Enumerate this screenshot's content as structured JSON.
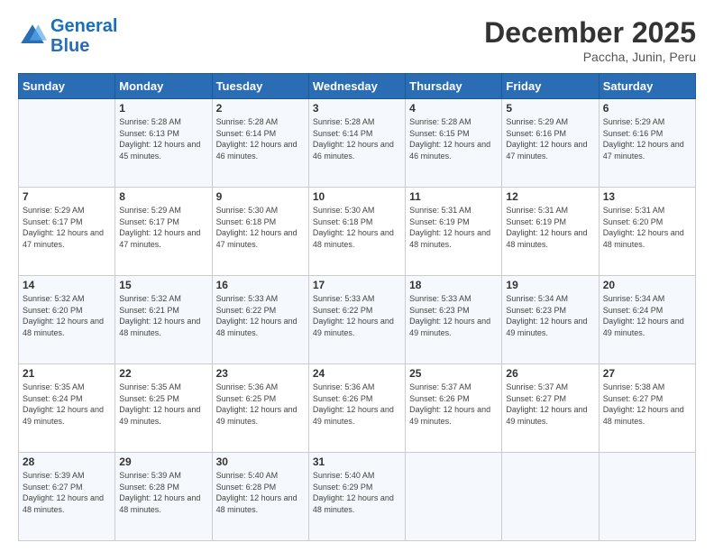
{
  "header": {
    "logo_line1": "General",
    "logo_line2": "Blue",
    "month_title": "December 2025",
    "location": "Paccha, Junin, Peru"
  },
  "weekdays": [
    "Sunday",
    "Monday",
    "Tuesday",
    "Wednesday",
    "Thursday",
    "Friday",
    "Saturday"
  ],
  "weeks": [
    [
      {
        "day": "",
        "sunrise": "",
        "sunset": "",
        "daylight": ""
      },
      {
        "day": "1",
        "sunrise": "Sunrise: 5:28 AM",
        "sunset": "Sunset: 6:13 PM",
        "daylight": "Daylight: 12 hours and 45 minutes."
      },
      {
        "day": "2",
        "sunrise": "Sunrise: 5:28 AM",
        "sunset": "Sunset: 6:14 PM",
        "daylight": "Daylight: 12 hours and 46 minutes."
      },
      {
        "day": "3",
        "sunrise": "Sunrise: 5:28 AM",
        "sunset": "Sunset: 6:14 PM",
        "daylight": "Daylight: 12 hours and 46 minutes."
      },
      {
        "day": "4",
        "sunrise": "Sunrise: 5:28 AM",
        "sunset": "Sunset: 6:15 PM",
        "daylight": "Daylight: 12 hours and 46 minutes."
      },
      {
        "day": "5",
        "sunrise": "Sunrise: 5:29 AM",
        "sunset": "Sunset: 6:16 PM",
        "daylight": "Daylight: 12 hours and 47 minutes."
      },
      {
        "day": "6",
        "sunrise": "Sunrise: 5:29 AM",
        "sunset": "Sunset: 6:16 PM",
        "daylight": "Daylight: 12 hours and 47 minutes."
      }
    ],
    [
      {
        "day": "7",
        "sunrise": "Sunrise: 5:29 AM",
        "sunset": "Sunset: 6:17 PM",
        "daylight": "Daylight: 12 hours and 47 minutes."
      },
      {
        "day": "8",
        "sunrise": "Sunrise: 5:29 AM",
        "sunset": "Sunset: 6:17 PM",
        "daylight": "Daylight: 12 hours and 47 minutes."
      },
      {
        "day": "9",
        "sunrise": "Sunrise: 5:30 AM",
        "sunset": "Sunset: 6:18 PM",
        "daylight": "Daylight: 12 hours and 47 minutes."
      },
      {
        "day": "10",
        "sunrise": "Sunrise: 5:30 AM",
        "sunset": "Sunset: 6:18 PM",
        "daylight": "Daylight: 12 hours and 48 minutes."
      },
      {
        "day": "11",
        "sunrise": "Sunrise: 5:31 AM",
        "sunset": "Sunset: 6:19 PM",
        "daylight": "Daylight: 12 hours and 48 minutes."
      },
      {
        "day": "12",
        "sunrise": "Sunrise: 5:31 AM",
        "sunset": "Sunset: 6:19 PM",
        "daylight": "Daylight: 12 hours and 48 minutes."
      },
      {
        "day": "13",
        "sunrise": "Sunrise: 5:31 AM",
        "sunset": "Sunset: 6:20 PM",
        "daylight": "Daylight: 12 hours and 48 minutes."
      }
    ],
    [
      {
        "day": "14",
        "sunrise": "Sunrise: 5:32 AM",
        "sunset": "Sunset: 6:20 PM",
        "daylight": "Daylight: 12 hours and 48 minutes."
      },
      {
        "day": "15",
        "sunrise": "Sunrise: 5:32 AM",
        "sunset": "Sunset: 6:21 PM",
        "daylight": "Daylight: 12 hours and 48 minutes."
      },
      {
        "day": "16",
        "sunrise": "Sunrise: 5:33 AM",
        "sunset": "Sunset: 6:22 PM",
        "daylight": "Daylight: 12 hours and 48 minutes."
      },
      {
        "day": "17",
        "sunrise": "Sunrise: 5:33 AM",
        "sunset": "Sunset: 6:22 PM",
        "daylight": "Daylight: 12 hours and 49 minutes."
      },
      {
        "day": "18",
        "sunrise": "Sunrise: 5:33 AM",
        "sunset": "Sunset: 6:23 PM",
        "daylight": "Daylight: 12 hours and 49 minutes."
      },
      {
        "day": "19",
        "sunrise": "Sunrise: 5:34 AM",
        "sunset": "Sunset: 6:23 PM",
        "daylight": "Daylight: 12 hours and 49 minutes."
      },
      {
        "day": "20",
        "sunrise": "Sunrise: 5:34 AM",
        "sunset": "Sunset: 6:24 PM",
        "daylight": "Daylight: 12 hours and 49 minutes."
      }
    ],
    [
      {
        "day": "21",
        "sunrise": "Sunrise: 5:35 AM",
        "sunset": "Sunset: 6:24 PM",
        "daylight": "Daylight: 12 hours and 49 minutes."
      },
      {
        "day": "22",
        "sunrise": "Sunrise: 5:35 AM",
        "sunset": "Sunset: 6:25 PM",
        "daylight": "Daylight: 12 hours and 49 minutes."
      },
      {
        "day": "23",
        "sunrise": "Sunrise: 5:36 AM",
        "sunset": "Sunset: 6:25 PM",
        "daylight": "Daylight: 12 hours and 49 minutes."
      },
      {
        "day": "24",
        "sunrise": "Sunrise: 5:36 AM",
        "sunset": "Sunset: 6:26 PM",
        "daylight": "Daylight: 12 hours and 49 minutes."
      },
      {
        "day": "25",
        "sunrise": "Sunrise: 5:37 AM",
        "sunset": "Sunset: 6:26 PM",
        "daylight": "Daylight: 12 hours and 49 minutes."
      },
      {
        "day": "26",
        "sunrise": "Sunrise: 5:37 AM",
        "sunset": "Sunset: 6:27 PM",
        "daylight": "Daylight: 12 hours and 49 minutes."
      },
      {
        "day": "27",
        "sunrise": "Sunrise: 5:38 AM",
        "sunset": "Sunset: 6:27 PM",
        "daylight": "Daylight: 12 hours and 48 minutes."
      }
    ],
    [
      {
        "day": "28",
        "sunrise": "Sunrise: 5:39 AM",
        "sunset": "Sunset: 6:27 PM",
        "daylight": "Daylight: 12 hours and 48 minutes."
      },
      {
        "day": "29",
        "sunrise": "Sunrise: 5:39 AM",
        "sunset": "Sunset: 6:28 PM",
        "daylight": "Daylight: 12 hours and 48 minutes."
      },
      {
        "day": "30",
        "sunrise": "Sunrise: 5:40 AM",
        "sunset": "Sunset: 6:28 PM",
        "daylight": "Daylight: 12 hours and 48 minutes."
      },
      {
        "day": "31",
        "sunrise": "Sunrise: 5:40 AM",
        "sunset": "Sunset: 6:29 PM",
        "daylight": "Daylight: 12 hours and 48 minutes."
      },
      {
        "day": "",
        "sunrise": "",
        "sunset": "",
        "daylight": ""
      },
      {
        "day": "",
        "sunrise": "",
        "sunset": "",
        "daylight": ""
      },
      {
        "day": "",
        "sunrise": "",
        "sunset": "",
        "daylight": ""
      }
    ]
  ]
}
